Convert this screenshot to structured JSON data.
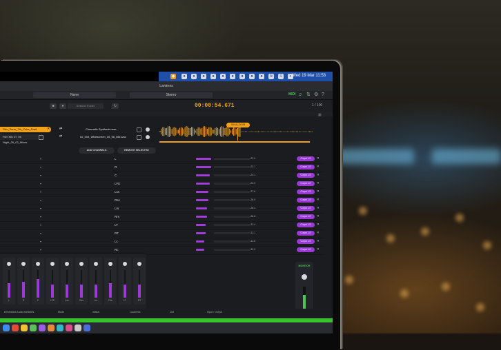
{
  "menubar": {
    "clock": "Wed 19 Mar  11:53"
  },
  "app": {
    "title": "Lanterns"
  },
  "toolbar": {
    "dropdown_left": "None",
    "dropdown_right": "Stereo",
    "midi_label": "MIDI",
    "timecode": "00:00:54.671",
    "location_field": "Session Folder",
    "pager": "1 / 100"
  },
  "files": [
    {
      "source": "Film_Stem_7th_Cues_Draft",
      "dest": "Cinematic Synthesis.wav",
      "selected": true
    },
    {
      "source": "Film Mix 07 7th Night_05_02_Mixes",
      "dest": "02_004_Widescreen_05_06_Mix.wav",
      "selected": false
    }
  ],
  "waveform": {
    "playhead_label": "00:01 | 00:05",
    "progress": 1.0
  },
  "actions": {
    "add_channels": "ADD CHANNELS",
    "remove_selected": "REMOVE SELECTED"
  },
  "channels": [
    {
      "label": "L",
      "db": "-22.5",
      "level": 0.55
    },
    {
      "label": "R",
      "db": "-22.1",
      "level": 0.55
    },
    {
      "label": "C",
      "db": "-24.1",
      "level": 0.5
    },
    {
      "label": "LFE",
      "db": "-24.0",
      "level": 0.5
    },
    {
      "label": "Lss",
      "db": "-27.6",
      "level": 0.45
    },
    {
      "label": "Rss",
      "db": "-28.0",
      "level": 0.45
    },
    {
      "label": "Lrs",
      "db": "-28.3",
      "level": 0.4
    },
    {
      "label": "Rrs",
      "db": "-28.8",
      "level": 0.4
    },
    {
      "label": "LT",
      "db": "-31.4",
      "level": 0.35
    },
    {
      "label": "RT",
      "db": "-31.1",
      "level": 0.35
    },
    {
      "label": "Lc",
      "db": "-31.6",
      "level": 0.3
    },
    {
      "label": "Rc",
      "db": "-32.0",
      "level": 0.3
    }
  ],
  "channel_pill_label": "Output 1/2",
  "mixer": {
    "strips": [
      {
        "label": "L",
        "level": 0.55
      },
      {
        "label": "R",
        "level": 0.6
      },
      {
        "label": "C",
        "level": 0.7
      },
      {
        "label": "LFE",
        "level": 0.5
      },
      {
        "label": "Lss",
        "level": 0.5
      },
      {
        "label": "Rss",
        "level": 0.5
      },
      {
        "label": "Lrs",
        "level": 0.5
      },
      {
        "label": "Rrs",
        "level": 0.55
      },
      {
        "label": "LT",
        "level": 0.5
      },
      {
        "label": "RT",
        "level": 0.5
      }
    ],
    "monitor_title": "MONITOR",
    "monitor_level": 0.7
  },
  "status": {
    "item1": "Embedded Audio Attributes",
    "item2": "Mode",
    "item3": "Status",
    "item4": "Loudness",
    "item5": "Out",
    "item6": "Input / Output"
  },
  "colors": {
    "accent_orange": "#f0a21c",
    "accent_purple": "#9b3ad6",
    "accent_green": "#4bc45a",
    "menubar_blue": "#1f4fa8"
  }
}
